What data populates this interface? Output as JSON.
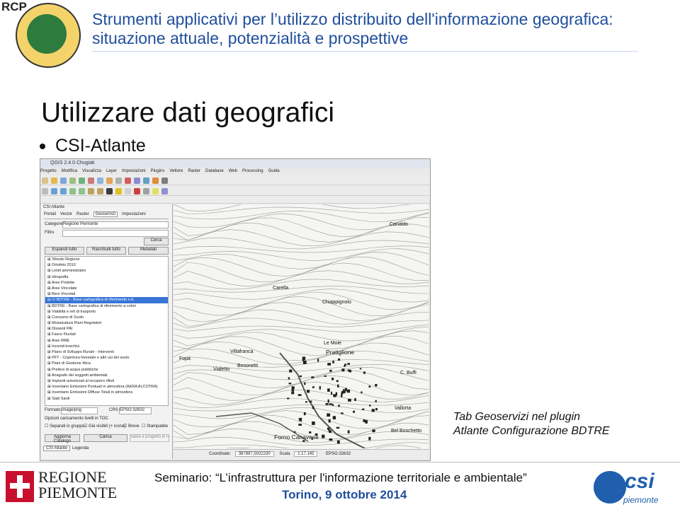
{
  "header": {
    "logo_text": "RCP",
    "title": "Strumenti applicativi per l’utilizzo distribuito dell'informazione geografica: situazione attuale, potenzialità e prospettive"
  },
  "slide": {
    "heading": "Utilizzare dati geografici",
    "bullet": "CSI-Atlante"
  },
  "qgis": {
    "window_title": "QGIS 2.4.0 Chugiak",
    "menu": [
      "Progetto",
      "Modifica",
      "Visualizza",
      "Layer",
      "Impostazioni",
      "Plugins",
      "Vettore",
      "Raster",
      "Database",
      "Web",
      "Processing",
      "Guida"
    ],
    "panel_title": "CSI Atlante",
    "tabs": [
      "Portali",
      "Vector",
      "Raster",
      "Geoservizi",
      "Impostazioni"
    ],
    "categoria_label": "Categorie",
    "categoria_value": "Regione Piemonte",
    "filtro_label": "Filtro",
    "cerca_button": "Cerca",
    "espandi_button": "Espandi tutto",
    "racchiudi_button": "Racchiudi tutto",
    "metadati_button": "Metadati",
    "layers": [
      "Sfondo Regione",
      "Ortofoto 2010",
      "Limiti amministrativi",
      "Idrografia",
      "Aree Protette",
      "Aree Vincolate",
      "Beni Vincolati",
      "BDTRE - Base cartografica di riferimento n.b.",
      "BDTRE - Base cartografica di riferimento a colori",
      "Viabilità e reti di trasporto",
      "Consumo di Suolo",
      "Mosaicatura Piani Regolatori",
      "Dissesti PAI",
      "Fasce Fluviali",
      "Aree RME",
      "Incendi boschivi",
      "Piano di Sviluppo Rurale - Interventi",
      "PFT - Copertura forestale e altri usi del suolo",
      "Piani di Gestione Ittica",
      "Prelievi di acque pubbliche",
      "Anagrafe dei soggetti ambientali",
      "Impianti autorizzati al recupero rifiuti",
      "Inventario Emissioni Puntuali in atmosfera (AERA ALCOTRA)",
      "Inventario Emissioni Diffuse Totali in atmosfera",
      "Stati Sardi"
    ],
    "formato_label": "Formato",
    "formato_value": "image/png",
    "crs_label": "CRS",
    "crs_value": "EPSG:32632",
    "opzioni_label": "Opzioni caricamento livelli in TOC",
    "check_separati": "Separati in gruppo",
    "check_visibili": "Già visibili (+ icona)",
    "check_breve": "Breve",
    "check_stampabile": "Stampabile",
    "aggiorna_button": "Aggiorna Catalogo",
    "carica_button": "Carica",
    "salva_hint": "Salva il progetto in remoto",
    "bottom_tabs": [
      "CSI Atlante",
      "Legenda"
    ],
    "status_coord_label": "Coordinate:",
    "status_coord": "387897,5022230",
    "status_scala_label": "Scala",
    "status_scala": "1:17.145",
    "status_epsg": "EPSG:32632",
    "place_names": [
      "Canaldo",
      "Carella",
      "Chiappignolo",
      "Pratiglione",
      "Villafranca",
      "Fopa",
      "Vialetto",
      "Bosonetti",
      "Vallorta",
      "Bel Boschetto",
      "C. Buffi",
      "Forno Canavese",
      "Le Moie"
    ]
  },
  "caption": {
    "line1": "Tab Geoservizi nel plugin",
    "line2": "Atlante Configurazione BDTRE"
  },
  "footer": {
    "region_line1": "REGIONE",
    "region_line2": "PIEMONTE",
    "seminar": "Seminario: “L’infrastruttura per l'informazione territoriale e ambientale”",
    "date": "Torino, 9 ottobre 2014",
    "csi_logo": "csi",
    "csi_sub": "piemonte"
  },
  "colors": {
    "title_blue": "#1f4e9c",
    "csi_blue": "#1f5fae",
    "region_red": "#c8102e"
  }
}
